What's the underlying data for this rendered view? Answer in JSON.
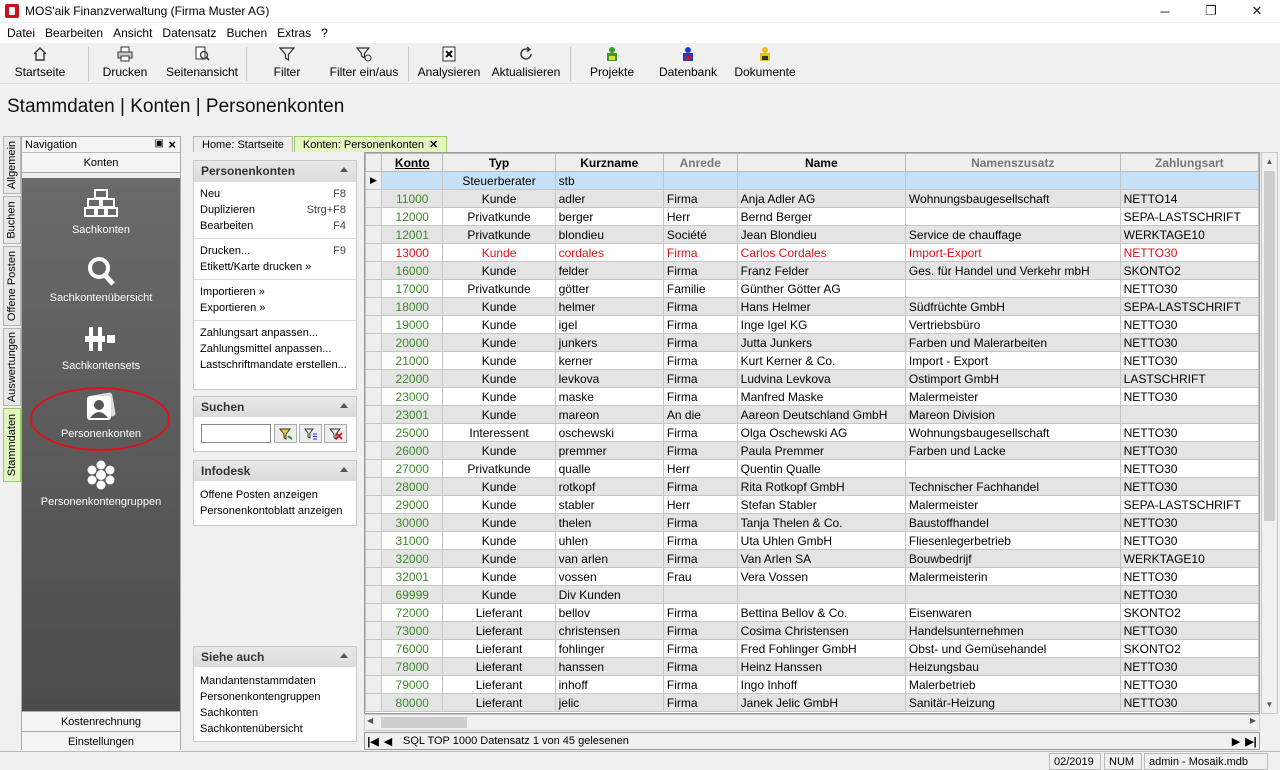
{
  "window": {
    "title": "MOS'aik Finanzverwaltung (Firma Muster AG)",
    "minimize": "─",
    "maximize": "❐",
    "close": "✕"
  },
  "menu": [
    "Datei",
    "Bearbeiten",
    "Ansicht",
    "Datensatz",
    "Buchen",
    "Extras",
    "?"
  ],
  "toolbar": [
    {
      "label": "Startseite",
      "icon": "home-icon"
    },
    {
      "label": "Drucken",
      "icon": "printer-icon"
    },
    {
      "label": "Seitenansicht",
      "icon": "print-preview-icon"
    },
    {
      "label": "Filter",
      "icon": "filter-icon"
    },
    {
      "label": "Filter ein/aus",
      "icon": "filter-toggle-icon"
    },
    {
      "label": "Analysieren",
      "icon": "analyze-icon"
    },
    {
      "label": "Aktualisieren",
      "icon": "refresh-icon"
    },
    {
      "label": "Projekte",
      "icon": "projects-icon"
    },
    {
      "label": "Datenbank",
      "icon": "database-icon"
    },
    {
      "label": "Dokumente",
      "icon": "documents-icon"
    }
  ],
  "breadcrumb": "Stammdaten | Konten | Personenkonten",
  "vtabs": [
    "Allgemein",
    "Buchen",
    "Offene Posten",
    "Auswertungen",
    "Stammdaten"
  ],
  "nav": {
    "header": "Navigation",
    "section": "Konten",
    "items": [
      "Sachkonten",
      "Sachkontenübersicht",
      "Sachkontensets",
      "Personenkonten",
      "Personenkontengruppen"
    ],
    "bottom": [
      "Kostenrechnung",
      "Einstellungen"
    ]
  },
  "tabs": [
    "Home: Startseite",
    "Konten: Personenkonten"
  ],
  "tasks": {
    "personenkonten": {
      "title": "Personenkonten",
      "g1": [
        {
          "l": "Neu",
          "k": "F8"
        },
        {
          "l": "Duplizieren",
          "k": "Strg+F8"
        },
        {
          "l": "Bearbeiten",
          "k": "F4"
        }
      ],
      "g2": [
        {
          "l": "Drucken...",
          "k": "F9"
        },
        {
          "l": "Etikett/Karte drucken »",
          "k": ""
        }
      ],
      "g3": [
        {
          "l": "Importieren »",
          "k": ""
        },
        {
          "l": "Exportieren »",
          "k": ""
        }
      ],
      "g4": [
        {
          "l": "Zahlungsart anpassen...",
          "k": ""
        },
        {
          "l": "Zahlungsmittel anpassen...",
          "k": ""
        },
        {
          "l": "Lastschriftmandate erstellen...",
          "k": ""
        }
      ]
    },
    "suchen": {
      "title": "Suchen",
      "value": ""
    },
    "infodesk": {
      "title": "Infodesk",
      "links": [
        "Offene Posten anzeigen",
        "Personenkontoblatt anzeigen"
      ]
    },
    "siehe": {
      "title": "Siehe auch",
      "links": [
        "Mandantenstammdaten",
        "Personenkontengruppen",
        "Sachkonten",
        "Sachkontenübersicht"
      ]
    }
  },
  "grid": {
    "columns": [
      "Konto",
      "Typ",
      "Kurzname",
      "Anrede",
      "Name",
      "Namenszusatz",
      "Zahlungsart"
    ],
    "rows": [
      [
        "",
        "Steuerberater",
        "stb",
        "",
        "",
        "",
        ""
      ],
      [
        "11000",
        "Kunde",
        "adler",
        "Firma",
        "Anja Adler AG",
        "Wohnungsbaugesellschaft",
        "NETTO14"
      ],
      [
        "12000",
        "Privatkunde",
        "berger",
        "Herr",
        "Bernd Berger",
        "",
        "SEPA-LASTSCHRIFT"
      ],
      [
        "12001",
        "Privatkunde",
        "blondieu",
        "Société",
        "Jean Blondieu",
        "Service de chauffage",
        "WERKTAGE10"
      ],
      [
        "13000",
        "Kunde",
        "cordales",
        "Firma",
        "Carlos Cordales",
        "Import-Export",
        "NETTO30"
      ],
      [
        "16000",
        "Kunde",
        "felder",
        "Firma",
        "Franz Felder",
        "Ges. für Handel und Verkehr mbH",
        "SKONTO2"
      ],
      [
        "17000",
        "Privatkunde",
        "götter",
        "Familie",
        "Günther Götter AG",
        "",
        "NETTO30"
      ],
      [
        "18000",
        "Kunde",
        "helmer",
        "Firma",
        "Hans Helmer",
        "Südfrüchte GmbH",
        "SEPA-LASTSCHRIFT"
      ],
      [
        "19000",
        "Kunde",
        "igel",
        "Firma",
        "Inge Igel KG",
        "Vertriebsbüro",
        "NETTO30"
      ],
      [
        "20000",
        "Kunde",
        "junkers",
        "Firma",
        "Jutta Junkers",
        "Farben und Malerarbeiten",
        "NETTO30"
      ],
      [
        "21000",
        "Kunde",
        "kerner",
        "Firma",
        "Kurt Kerner & Co.",
        "Import - Export",
        "NETTO30"
      ],
      [
        "22000",
        "Kunde",
        "levkova",
        "Firma",
        "Ludvina Levkova",
        "Ostimport GmbH",
        "LASTSCHRIFT"
      ],
      [
        "23000",
        "Kunde",
        "maske",
        "Firma",
        "Manfred Maske",
        "Malermeister",
        "NETTO30"
      ],
      [
        "23001",
        "Kunde",
        "mareon",
        "An die",
        "Aareon Deutschland GmbH",
        "Mareon Division",
        ""
      ],
      [
        "25000",
        "Interessent",
        "oschewski",
        "Firma",
        "Olga Oschewski AG",
        "Wohnungsbaugesellschaft",
        "NETTO30"
      ],
      [
        "26000",
        "Kunde",
        "premmer",
        "Firma",
        "Paula Premmer",
        "Farben und Lacke",
        "NETTO30"
      ],
      [
        "27000",
        "Privatkunde",
        "qualle",
        "Herr",
        "Quentin Qualle",
        "",
        "NETTO30"
      ],
      [
        "28000",
        "Kunde",
        "rotkopf",
        "Firma",
        "Rita Rotkopf GmbH",
        "Technischer Fachhandel",
        "NETTO30"
      ],
      [
        "29000",
        "Kunde",
        "stabler",
        "Herr",
        "Stefan Stabler",
        "Malermeister",
        "SEPA-LASTSCHRIFT"
      ],
      [
        "30000",
        "Kunde",
        "thelen",
        "Firma",
        "Tanja Thelen & Co.",
        "Baustoffhandel",
        "NETTO30"
      ],
      [
        "31000",
        "Kunde",
        "uhlen",
        "Firma",
        "Uta Uhlen GmbH",
        "Fliesenlegerbetrieb",
        "NETTO30"
      ],
      [
        "32000",
        "Kunde",
        "van arlen",
        "Firma",
        "Van Arlen SA",
        "Bouwbedrijf",
        "WERKTAGE10"
      ],
      [
        "32001",
        "Kunde",
        "vossen",
        "Frau",
        "Vera Vossen",
        "Malermeisterin",
        "NETTO30"
      ],
      [
        "69999",
        "Kunde",
        "Div Kunden",
        "",
        "",
        "",
        "NETTO30"
      ],
      [
        "72000",
        "Lieferant",
        "bellov",
        "Firma",
        "Bettina Bellov & Co.",
        "Eisenwaren",
        "SKONTO2"
      ],
      [
        "73000",
        "Lieferant",
        "christensen",
        "Firma",
        "Cosima Christensen",
        "Handelsunternehmen",
        "NETTO30"
      ],
      [
        "76000",
        "Lieferant",
        "fohlinger",
        "Firma",
        "Fred Fohlinger GmbH",
        "Obst- und Gemüsehandel",
        "SKONTO2"
      ],
      [
        "78000",
        "Lieferant",
        "hanssen",
        "Firma",
        "Heinz Hanssen",
        "Heizungsbau",
        "NETTO30"
      ],
      [
        "79000",
        "Lieferant",
        "inhoff",
        "Firma",
        "Ingo Inhoff",
        "Malerbetrieb",
        "NETTO30"
      ],
      [
        "80000",
        "Lieferant",
        "jelic",
        "Firma",
        "Janek Jelic GmbH",
        "Sanitär-Heizung",
        "NETTO30"
      ]
    ],
    "red_row": "13000",
    "status": "SQL TOP 1000 Datensatz 1 von 45 gelesenen"
  },
  "statusbar": {
    "period": "02/2019",
    "num": "NUM",
    "db": "admin - Mosaik.mdb"
  },
  "colors": {
    "konto": "#3f8a2a",
    "highlight": "#c6e1f7",
    "red": "#e0111d",
    "activeTab": "#e3f5c0"
  }
}
